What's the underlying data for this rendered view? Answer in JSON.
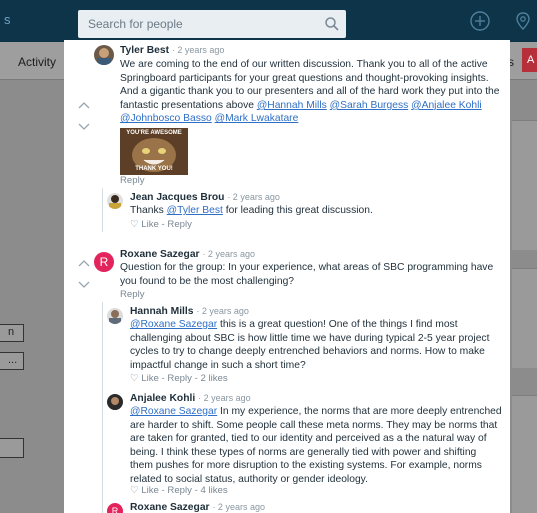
{
  "topbar": {
    "brand_fragment": "s",
    "search_placeholder": "Search for people"
  },
  "subbar": {
    "activity_label": "Activity",
    "s_fragment": "s",
    "red_fragment": "A"
  },
  "side_buttons": [
    "n",
    "..."
  ],
  "comments": [
    {
      "author": "Tyler Best",
      "time": "· 2 years ago",
      "text_lines": [
        "We are coming to the end of our written discussion. Thank you to all of the active",
        "Springboard participants for your great questions and thought-provoking insights.",
        "And a gigantic thank you to our presenters and all of the hard work they put into the"
      ],
      "line4_prefix": "fantastic presentations above ",
      "mentions_line4": [
        "@Hannah Mills",
        "@Sarah Burgess",
        "@Anjalee Kohli"
      ],
      "mentions_line5": [
        "@Johnbosco Basso",
        "@Mark Lwakatare"
      ],
      "meme_top": "YOU'RE AWESOME",
      "meme_bottom": "THANK YOU!",
      "reply_label": "Reply"
    },
    {
      "author": "Jean Jacques Brou",
      "time": "· 2 years ago",
      "text_before": "Thanks ",
      "mention": "@Tyler Best",
      "text_after": " for leading this great discussion.",
      "actions": "♡ Like - Reply"
    },
    {
      "author": "Roxane Sazegar",
      "avatar_letter": "R",
      "time": "· 2 years ago",
      "text_lines": [
        "Question for the group: In your experience, what areas of SBC programming have",
        "you found to be the most challenging?"
      ],
      "reply_label": "Reply"
    },
    {
      "author": "Hannah Mills",
      "time": "· 2 years ago",
      "mention": "@Roxane Sazegar",
      "line1_after": " this is a great question! One of the things I find most",
      "text_lines": [
        "challenging about SBC is how little time we have during typical 2-5 year project",
        "cycles to try to change deeply entrenched behaviors and norms. How to make",
        "impactful change in such a short time?"
      ],
      "actions": "♡ Like - Reply - 2 likes"
    },
    {
      "author": "Anjalee Kohli",
      "time": "· 2 years ago",
      "mention": "@Roxane Sazegar",
      "line1_after": " In my experience, the norms that are more deeply entrenched",
      "text_lines": [
        "are harder to shift. Some people call these meta norms. They may be norms that",
        "are taken for granted, tied to our identity and perceived as a the natural way of",
        "being. I think these types of norms are generally tied with power and shifting",
        "them pushes for more disruption to the existing systems. For example, norms",
        "related to social status, authority or gender ideology."
      ],
      "actions": "♡ Like - Reply - 4 likes"
    },
    {
      "author": "Roxane Sazegar",
      "avatar_letter": "R",
      "time": "· 2 years ago"
    }
  ],
  "colors": {
    "topbar": "#0d3448",
    "mention": "#2f6fc6",
    "avatar_red": "#e3245c",
    "overlay": "#8c8c8c"
  }
}
